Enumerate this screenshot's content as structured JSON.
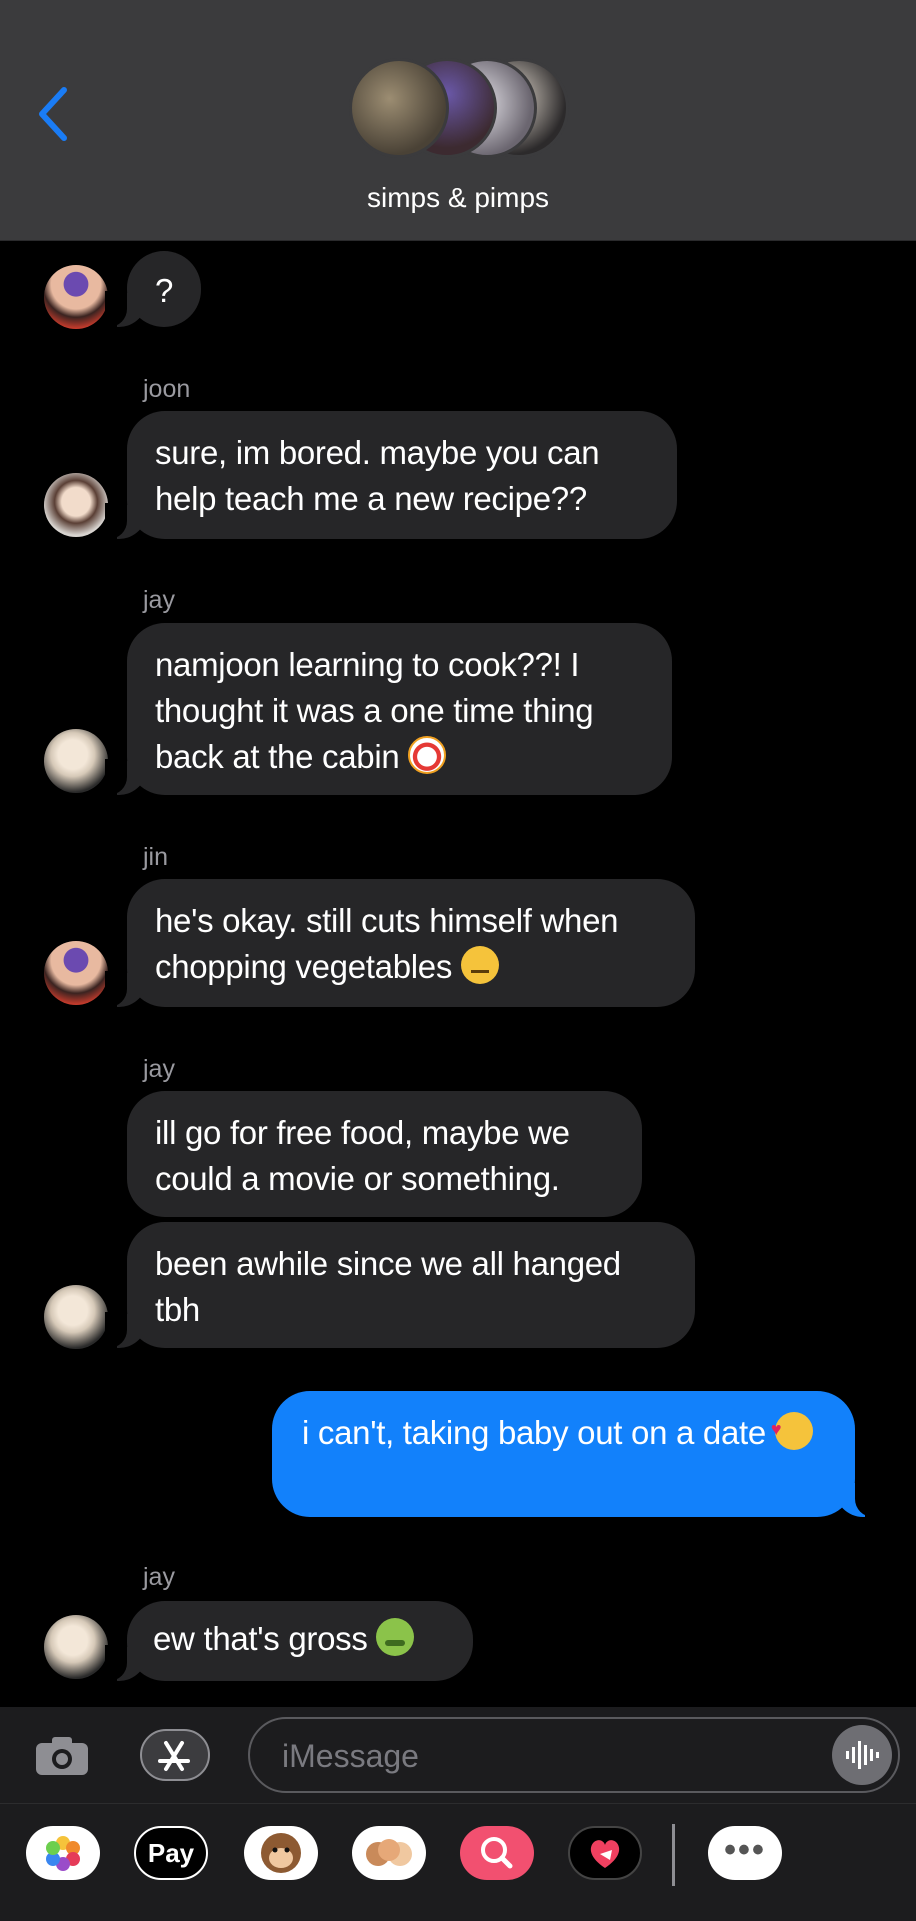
{
  "header": {
    "back_icon": "chevron-left-icon",
    "accent_color": "#1a7cf5",
    "group_name": "simps & pimps"
  },
  "messages": [
    {
      "sender": "",
      "text": "?"
    },
    {
      "sender": "joon",
      "text": "sure, im bored. maybe you can help teach me a new recipe??"
    },
    {
      "sender": "jay",
      "text": "namjoon learning to cook??! I thought it was a one time thing back at the cabin",
      "emoji": "clown-face-emoji"
    },
    {
      "sender": "jin",
      "text": "he's okay. still cuts himself when chopping vegetables",
      "emoji": "neutral-face-emoji"
    },
    {
      "sender": "jay",
      "text": "ill go for free food, maybe we could a movie or something."
    },
    {
      "sender": "",
      "text": "been awhile since we all hanged tbh"
    },
    {
      "sender": "me",
      "text": "i can't, taking baby out on a date",
      "emoji": "smiling-face-with-hearts-emoji"
    },
    {
      "sender": "jay",
      "text": "ew that's gross",
      "emoji": "nauseated-face-emoji"
    }
  ],
  "composer": {
    "placeholder": "iMessage",
    "camera_icon": "camera-icon",
    "apps_icon": "app-store-icon",
    "voice_icon": "audio-waveform-icon"
  },
  "app_tray": {
    "items": [
      "photos-icon",
      "Pay",
      "memoji-monkey-icon",
      "memoji-stickers-icon",
      "image-search-icon",
      "digital-touch-icon",
      "more-icon"
    ],
    "pay_label": "Pay",
    "more_label": "•••"
  },
  "colors": {
    "incoming_bubble": "#262628",
    "outgoing_bubble": "#1281fb",
    "header_bg": "#3b3b3d"
  }
}
